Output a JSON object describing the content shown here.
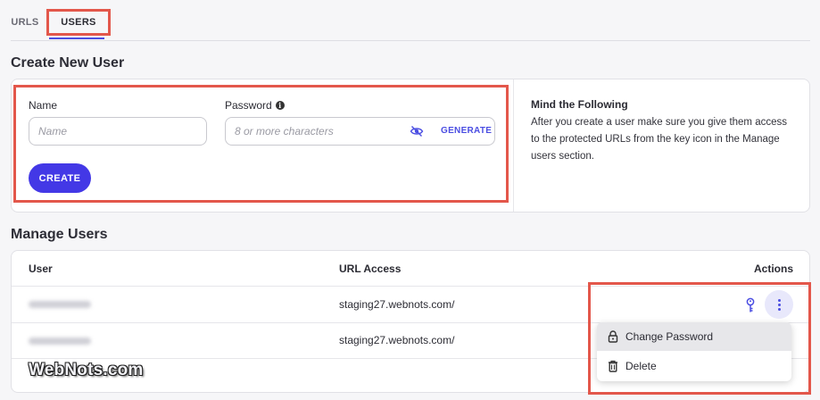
{
  "tabs": [
    {
      "label": "URLS"
    },
    {
      "label": "USERS"
    }
  ],
  "create": {
    "title": "Create New User",
    "name_label": "Name",
    "name_placeholder": "Name",
    "password_label": "Password",
    "password_placeholder": "8 or more characters",
    "generate_label": "GENERATE",
    "create_button": "CREATE"
  },
  "notice": {
    "title": "Mind the Following",
    "text": "After you create a user make sure you give them access to the protected URLs from the key icon in the Manage users section."
  },
  "manage": {
    "title": "Manage Users",
    "columns": [
      "User",
      "URL Access",
      "Actions"
    ],
    "rows": [
      {
        "url": "staging27.webnots.com/"
      },
      {
        "url": "staging27.webnots.com/"
      }
    ]
  },
  "menu": {
    "items": [
      {
        "label": "Change Password",
        "icon": "lock-icon"
      },
      {
        "label": "Delete",
        "icon": "trash-icon"
      }
    ]
  },
  "watermark": "WebNots.com",
  "colors": {
    "accent": "#4338e6",
    "highlight_box": "#e3574b"
  }
}
